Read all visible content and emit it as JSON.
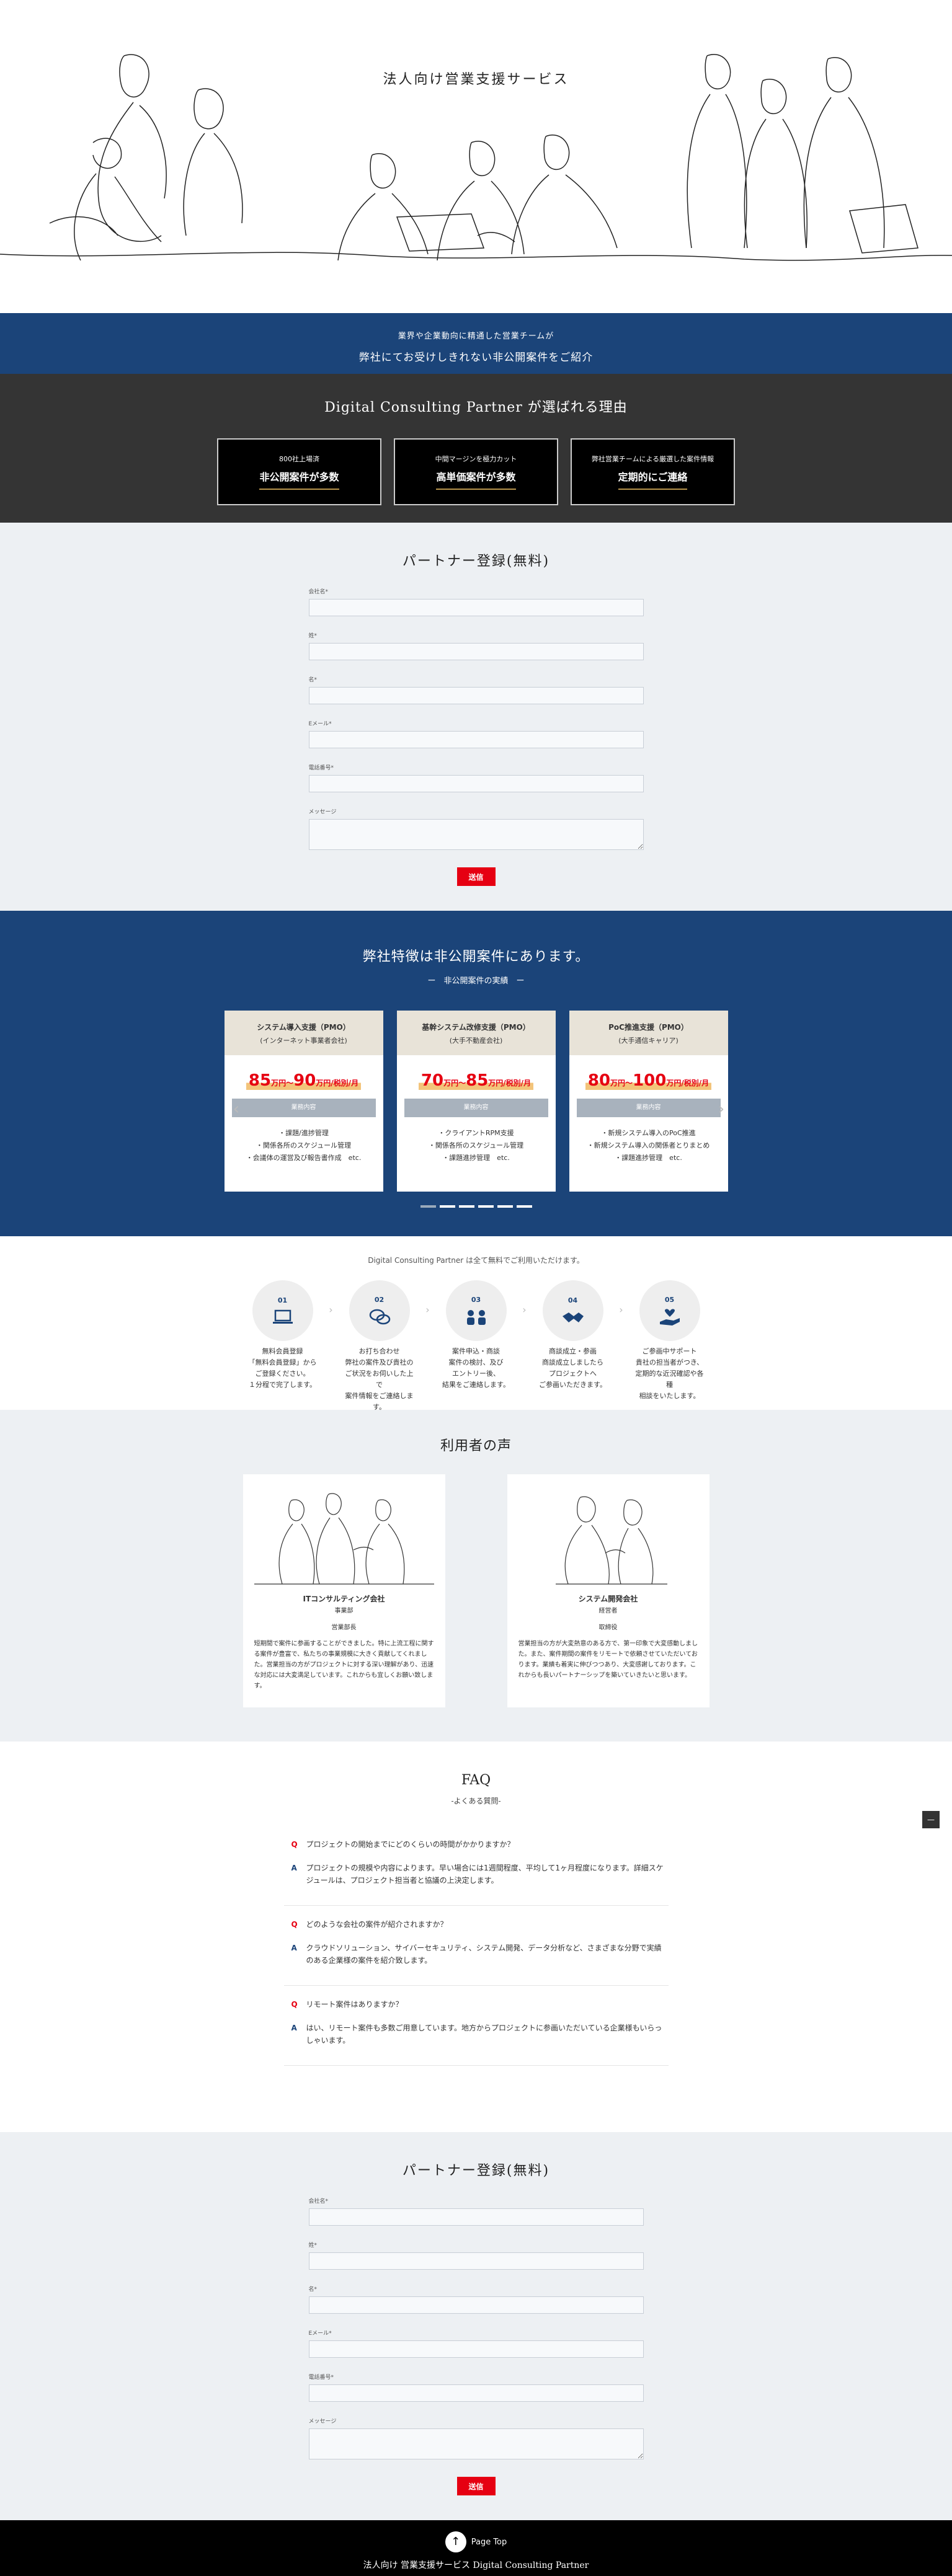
{
  "hero": {
    "title": "法人向け営業支援サービス"
  },
  "band": {
    "line1": "業界や企業動向に精通した営業チームが",
    "line2": "弊社にてお受けしきれない非公開案件をご紹介"
  },
  "reasons": {
    "title": "Digital Consulting Partner が選ばれる理由",
    "items": [
      {
        "small": "800社上場済",
        "big": "非公開案件が多数"
      },
      {
        "small": "中間マージンを極力カット",
        "big": "高単価案件が多数"
      },
      {
        "small": "弊社営業チームによる厳選した案件情報",
        "big": "定期的にご連絡"
      }
    ]
  },
  "form": {
    "title": "パートナー登録(無料)",
    "fields": [
      {
        "label": "会社名*"
      },
      {
        "label": "姓*"
      },
      {
        "label": "名*"
      },
      {
        "label": "Eメール*"
      },
      {
        "label": "電話番号*"
      },
      {
        "label": "メッセージ"
      }
    ],
    "submit": "送信"
  },
  "projects": {
    "title": "弊社特徴は非公開案件にあります。",
    "sub": "ー　非公開案件の実績　ー",
    "biz_label": "業務内容",
    "cards": [
      {
        "title": "システム導入支援（PMO）",
        "client": "(インターネット事業者会社)",
        "price": "85万円〜90万円",
        "unit": "万円/税別/月",
        "items": [
          "・課題/進捗管理",
          "・関係各所のスケジュール管理",
          "・会議体の運営及び報告書作成　etc."
        ]
      },
      {
        "title": "基幹システム改修支援（PMO）",
        "client": "(大手不動産会社)",
        "price": "70万円〜85万円",
        "unit": "万円/税別/月",
        "items": [
          "・クライアントRPM支援",
          "・関係各所のスケジュール管理",
          "・課題進捗管理　etc."
        ]
      },
      {
        "title": "PoC推進支援（PMO）",
        "client": "(大手通信キャリア)",
        "price": "80万円〜100万円",
        "unit": "万円/税別/月",
        "items": [
          "・新規システム導入のPoC推進",
          "・新規システム導入の関係者とりまとめ",
          "・課題進捗管理　etc."
        ]
      }
    ],
    "prices": [
      {
        "a": "85",
        "b": "90"
      },
      {
        "a": "70",
        "b": "85"
      },
      {
        "a": "80",
        "b": "100"
      }
    ]
  },
  "steps": {
    "intro": "Digital Consulting Partner は全て無料でご利用いただけます。",
    "items": [
      {
        "num": "01",
        "name": "無料会員登録",
        "desc1": "「無料会員登録」から",
        "desc2": "ご登録ください。",
        "desc3": "１分程で完了します。",
        "icon": "laptop-icon"
      },
      {
        "num": "02",
        "name": "お打ち合わせ",
        "desc1": "弊社の案件及び貴社の",
        "desc2": "ご状況をお伺いした上で",
        "desc3": "案件情報をご連絡します。",
        "icon": "chat-icon"
      },
      {
        "num": "03",
        "name": "案件申込・商談",
        "desc1": "案件の検討、及び",
        "desc2": "エントリー後、",
        "desc3": "結果をご連絡します。",
        "icon": "meeting-icon"
      },
      {
        "num": "04",
        "name": "商談成立・参画",
        "desc1": "商談成立しましたら",
        "desc2": "プロジェクトへ",
        "desc3": "ご参画いただきます。",
        "icon": "handshake-icon"
      },
      {
        "num": "05",
        "name": "ご参画中サポート",
        "desc1": "貴社の担当者がつき、",
        "desc2": "定期的な近況確認や各種",
        "desc3": "相談をいたします。",
        "icon": "support-icon"
      }
    ]
  },
  "voice": {
    "title": "利用者の声",
    "cards": [
      {
        "company": "ITコンサルティング会社",
        "dept": "事業部",
        "role": "営業部長",
        "text": "短期間で案件に参画することができました。特に上流工程に関する案件が豊富で、私たちの事業規模に大きく貢献してくれました。営業担当の方がプロジェクトに対する深い理解があり、迅速な対応には大変満足しています。これからも宜しくお願い致します。"
      },
      {
        "company": "システム開発会社",
        "dept": "経営者",
        "role": "取締役",
        "text": "営業担当の方が大変熱意のある方で、第一印象で大変感動しました。また、案件期間の案件をリモートで依頼させていただいております。業績も着実に伸びつつあり、大変感謝しております。これからも長いパートナーシップを築いていきたいと思います。"
      }
    ]
  },
  "faq": {
    "title": "FAQ",
    "sub": "-よくある質問-",
    "items": [
      {
        "q": "プロジェクトの開始までにどのくらいの時間がかかりますか？",
        "a": "プロジェクトの規模や内容によります。早い場合には1週間程度、平均して1ヶ月程度になります。詳細スケジュールは、プロジェクト担当者と協議の上決定します。"
      },
      {
        "q": "どのような会社の案件が紹介されますか？",
        "a": "クラウドソリューション、サイバーセキュリティ、システム開発、データ分析など、さまざまな分野で実績のある企業様の案件を紹介致します。"
      },
      {
        "q": "リモート案件はありますか？",
        "a": "はい、リモート案件も多数ご用意しています。地方からプロジェクトに参画いただいている企業様もいらっしゃいます。"
      }
    ],
    "q_mark": "Q",
    "a_mark": "A"
  },
  "totop_small": "—",
  "footer": {
    "page_top": "Page Top",
    "copy": "法人向け 営業支援サービス Digital Consulting Partner"
  }
}
